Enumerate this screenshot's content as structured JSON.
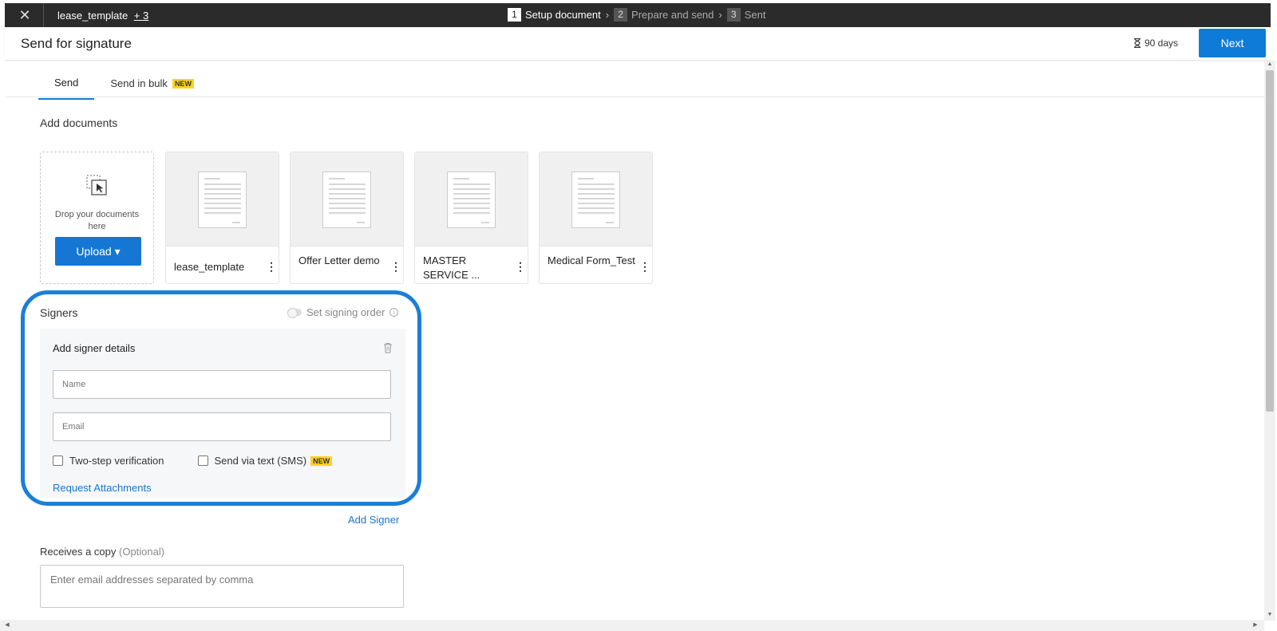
{
  "topbar": {
    "close_icon": "close-icon",
    "doc_title": "lease_template",
    "doc_more": "+ 3",
    "steps": [
      {
        "num": "1",
        "label": "Setup document"
      },
      {
        "num": "2",
        "label": "Prepare and send"
      },
      {
        "num": "3",
        "label": "Sent"
      }
    ],
    "chevron": "›"
  },
  "header": {
    "title": "Send for signature",
    "expiry": "90 days",
    "expiry_icon": "hourglass-icon",
    "next_label": "Next"
  },
  "tabs": [
    {
      "label": "Send"
    },
    {
      "label": "Send in bulk",
      "badge": "NEW"
    }
  ],
  "documents": {
    "title": "Add documents",
    "drop_text": "Drop your documents here",
    "upload_label": "Upload ▾",
    "files": [
      {
        "name": "lease_template"
      },
      {
        "name": "Offer Letter demo"
      },
      {
        "name": "MASTER SERVICE ..."
      },
      {
        "name": "Medical Form_Test"
      }
    ],
    "menu_glyph": "⋮"
  },
  "signers": {
    "title": "Signers",
    "signing_order_label": "Set signing order",
    "panel_title": "Add signer details",
    "name_placeholder": "Name",
    "email_placeholder": "Email",
    "two_step_label": "Two-step verification",
    "sms_label": "Send via text (SMS)",
    "sms_badge": "NEW",
    "request_attachments": "Request Attachments",
    "add_signer": "Add Signer"
  },
  "copy": {
    "label": "Receives a copy",
    "optional": "(Optional)",
    "placeholder": "Enter email addresses separated by comma"
  },
  "colors": {
    "accent": "#0f7bd9",
    "topbar": "#2b2b2b",
    "badge": "#ffd21f",
    "highlight": "#1a7fd8"
  }
}
